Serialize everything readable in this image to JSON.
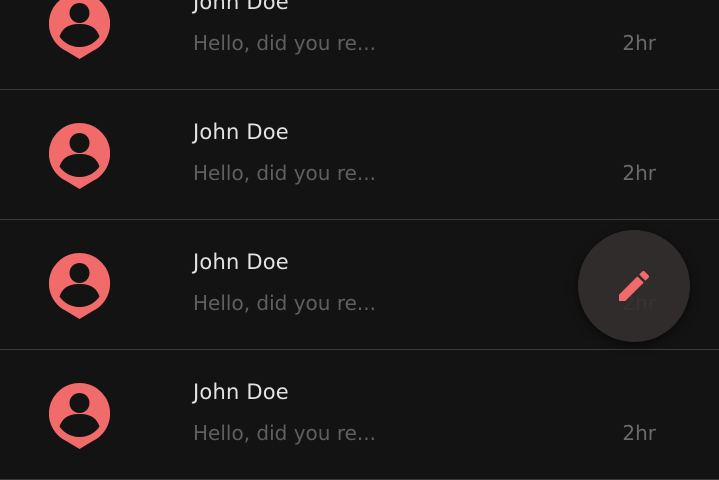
{
  "accent_color": "#f26b6b",
  "conversations": [
    {
      "name": "John Doe",
      "preview": "Hello, did you re...",
      "time": "2hr",
      "avatar_icon": "user-avatar-icon"
    },
    {
      "name": "John Doe",
      "preview": "Hello, did you re...",
      "time": "2hr",
      "avatar_icon": "user-avatar-icon"
    },
    {
      "name": "John Doe",
      "preview": "Hello, did you re...",
      "time": "2hr",
      "avatar_icon": "user-avatar-icon"
    },
    {
      "name": "John Doe",
      "preview": "Hello, did you re...",
      "time": "2hr",
      "avatar_icon": "user-avatar-icon"
    }
  ],
  "fab": {
    "icon": "pencil-icon"
  }
}
